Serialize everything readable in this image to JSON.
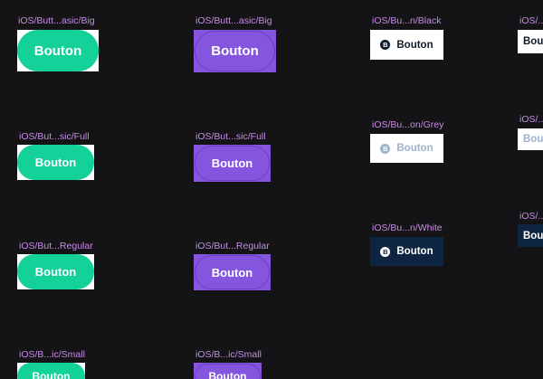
{
  "button_text": "Bouton",
  "coin_glyph": "B",
  "colors": {
    "canvas": "#141416",
    "label": "#c78be6",
    "green": "#13d199",
    "purple": "#8555e0",
    "navy": "#0e2541",
    "black_text": "#0e1b2b",
    "grey_text": "#9db2cc"
  },
  "labels": {
    "basic_big_green": "iOS/Butt...asic/Big",
    "basic_big_purple": "iOS/Butt...asic/Big",
    "basic_full_green": "iOS/But...sic/Full",
    "basic_full_purple": "iOS/But...sic/Full",
    "regular_green": "iOS/But...Regular",
    "regular_purple": "iOS/But...Regular",
    "small_green": "iOS/B...ic/Small",
    "small_purple": "iOS/B...ic/Small",
    "black": "iOS/Bu...n/Black",
    "grey": "iOS/Bu...on/Grey",
    "white": "iOS/Bu...n/White",
    "col4_a": "iOS/...",
    "col4_b": "iOS/...",
    "col4_c": "iOS/..."
  }
}
